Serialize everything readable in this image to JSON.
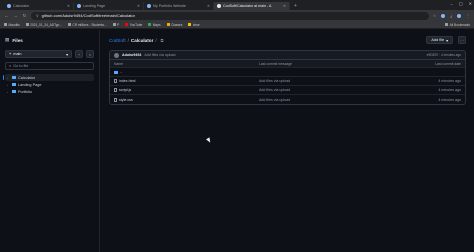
{
  "browser": {
    "tabs": [
      {
        "label": "Calculator",
        "active": false
      },
      {
        "label": "Landing Page",
        "active": false
      },
      {
        "label": "My Portfolio Website",
        "active": false
      },
      {
        "label": "CodSoft/Calculator at main - A",
        "active": true
      }
    ],
    "url": "github.com/Adulsr9494/CodSoft/tree/main/Calculator",
    "bookmarks": [
      {
        "label": "Maudits",
        "kind": "generic"
      },
      {
        "label": "2021_01_24_ADTyp...",
        "kind": "generic"
      },
      {
        "label": "CR millions - Students...",
        "kind": "generic"
      },
      {
        "label": "P",
        "kind": "generic"
      },
      {
        "label": "YouTube",
        "kind": "yt"
      },
      {
        "label": "Maps",
        "kind": "mp"
      },
      {
        "label": "Classes",
        "kind": "cl"
      },
      {
        "label": "cbse",
        "kind": "nf"
      }
    ],
    "all_bookmarks_label": "All Bookmarks"
  },
  "sidebar": {
    "title": "Files",
    "branch": "main",
    "go_to_file_placeholder": "Go to file",
    "tree": [
      {
        "label": "Calculator",
        "selected": true
      },
      {
        "label": "Landing Page",
        "selected": false
      },
      {
        "label": "Portfolio",
        "selected": false
      }
    ]
  },
  "main": {
    "repo": "CodSoft",
    "folder": "Calculator",
    "add_file_label": "Add file",
    "commit": {
      "user": "Adulsr9494",
      "message": "Add files via upload",
      "meta": "e9f3870 · 4 minutes ago"
    },
    "table": {
      "headers": {
        "name": "Name",
        "message": "Last commit message",
        "date": "Last commit date"
      },
      "parent": "..",
      "rows": [
        {
          "name": "index.html",
          "message": "Add files via upload",
          "date": "4 minutes ago"
        },
        {
          "name": "script.js",
          "message": "Add files via upload",
          "date": "4 minutes ago"
        },
        {
          "name": "style.css",
          "message": "Add files via upload",
          "date": "4 minutes ago"
        }
      ]
    }
  }
}
